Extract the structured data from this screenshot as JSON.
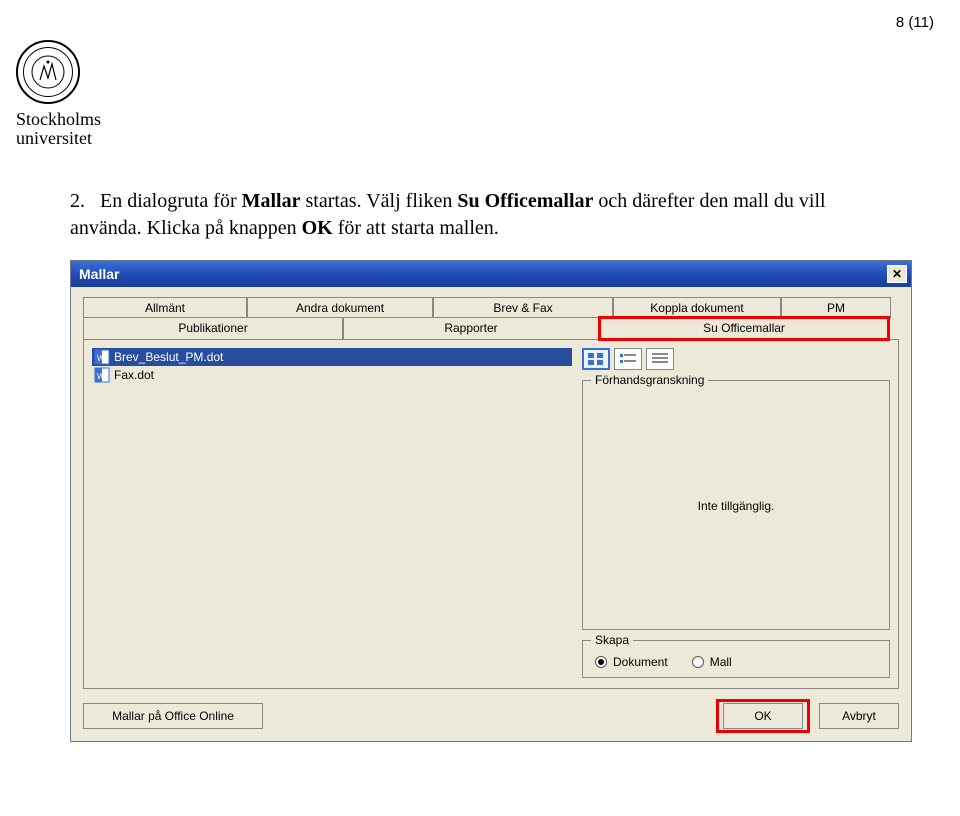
{
  "page_number": "8 (11)",
  "university": {
    "line1": "Stockholms",
    "line2": "universitet"
  },
  "instruction": {
    "num": "2.",
    "t1": "En dialogruta för ",
    "b1": "Mallar",
    "t2": " startas. Välj fliken ",
    "b2": "Su Officemallar",
    "t3": " och därefter den mall du vill använda. Klicka på knappen ",
    "b3": "OK",
    "t4": " för att starta mallen."
  },
  "dialog": {
    "title": "Mallar",
    "close": "✕",
    "tabs_top": [
      "Allmänt",
      "Andra dokument",
      "Brev & Fax",
      "Koppla dokument",
      "PM"
    ],
    "tabs_bottom": [
      "Publikationer",
      "Rapporter",
      "Su Officemallar"
    ],
    "files": [
      "Brev_Beslut_PM.dot",
      "Fax.dot"
    ],
    "preview_legend": "Förhandsgranskning",
    "preview_text": "Inte tillgänglig.",
    "create_legend": "Skapa",
    "create_options": [
      "Dokument",
      "Mall"
    ],
    "footer": {
      "online": "Mallar på Office Online",
      "ok": "OK",
      "cancel": "Avbryt"
    }
  }
}
